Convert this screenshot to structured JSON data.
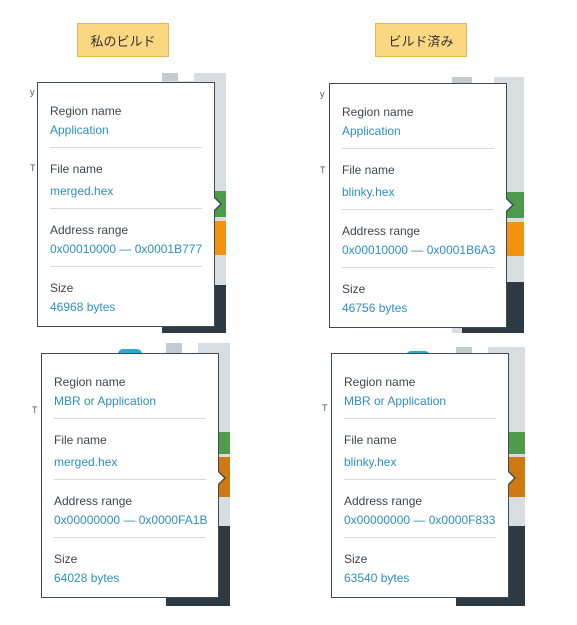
{
  "captions": {
    "left": "私のビルド",
    "right": "ビルド済み"
  },
  "panels": [
    {
      "fields": [
        {
          "label": "Region name",
          "value": "Application"
        },
        {
          "label": "File name",
          "value": "merged.hex"
        },
        {
          "label": "Address range",
          "value": "0x00010000 — 0x0001B777"
        },
        {
          "label": "Size",
          "value": "46968 bytes"
        }
      ]
    },
    {
      "fields": [
        {
          "label": "Region name",
          "value": "Application"
        },
        {
          "label": "File name",
          "value": "blinky.hex"
        },
        {
          "label": "Address range",
          "value": "0x00010000 — 0x0001B6A3"
        },
        {
          "label": "Size",
          "value": "46756 bytes"
        }
      ]
    },
    {
      "fields": [
        {
          "label": "Region name",
          "value": "MBR or Application"
        },
        {
          "label": "File name",
          "value": "merged.hex"
        },
        {
          "label": "Address range",
          "value": "0x00000000 — 0x0000FA1B"
        },
        {
          "label": "Size",
          "value": "64028 bytes"
        }
      ]
    },
    {
      "fields": [
        {
          "label": "Region name",
          "value": "MBR or Application"
        },
        {
          "label": "File name",
          "value": "blinky.hex"
        },
        {
          "label": "Address range",
          "value": "0x00000000 — 0x0000F833"
        },
        {
          "label": "Size",
          "value": "63540 bytes"
        }
      ]
    }
  ],
  "colors": {
    "caption_bg": "#fcd782",
    "value_text": "#2d8fbf",
    "green_region": "#4e9b4e",
    "orange_region": "#f4920f",
    "dark_log": "#2d3943"
  }
}
